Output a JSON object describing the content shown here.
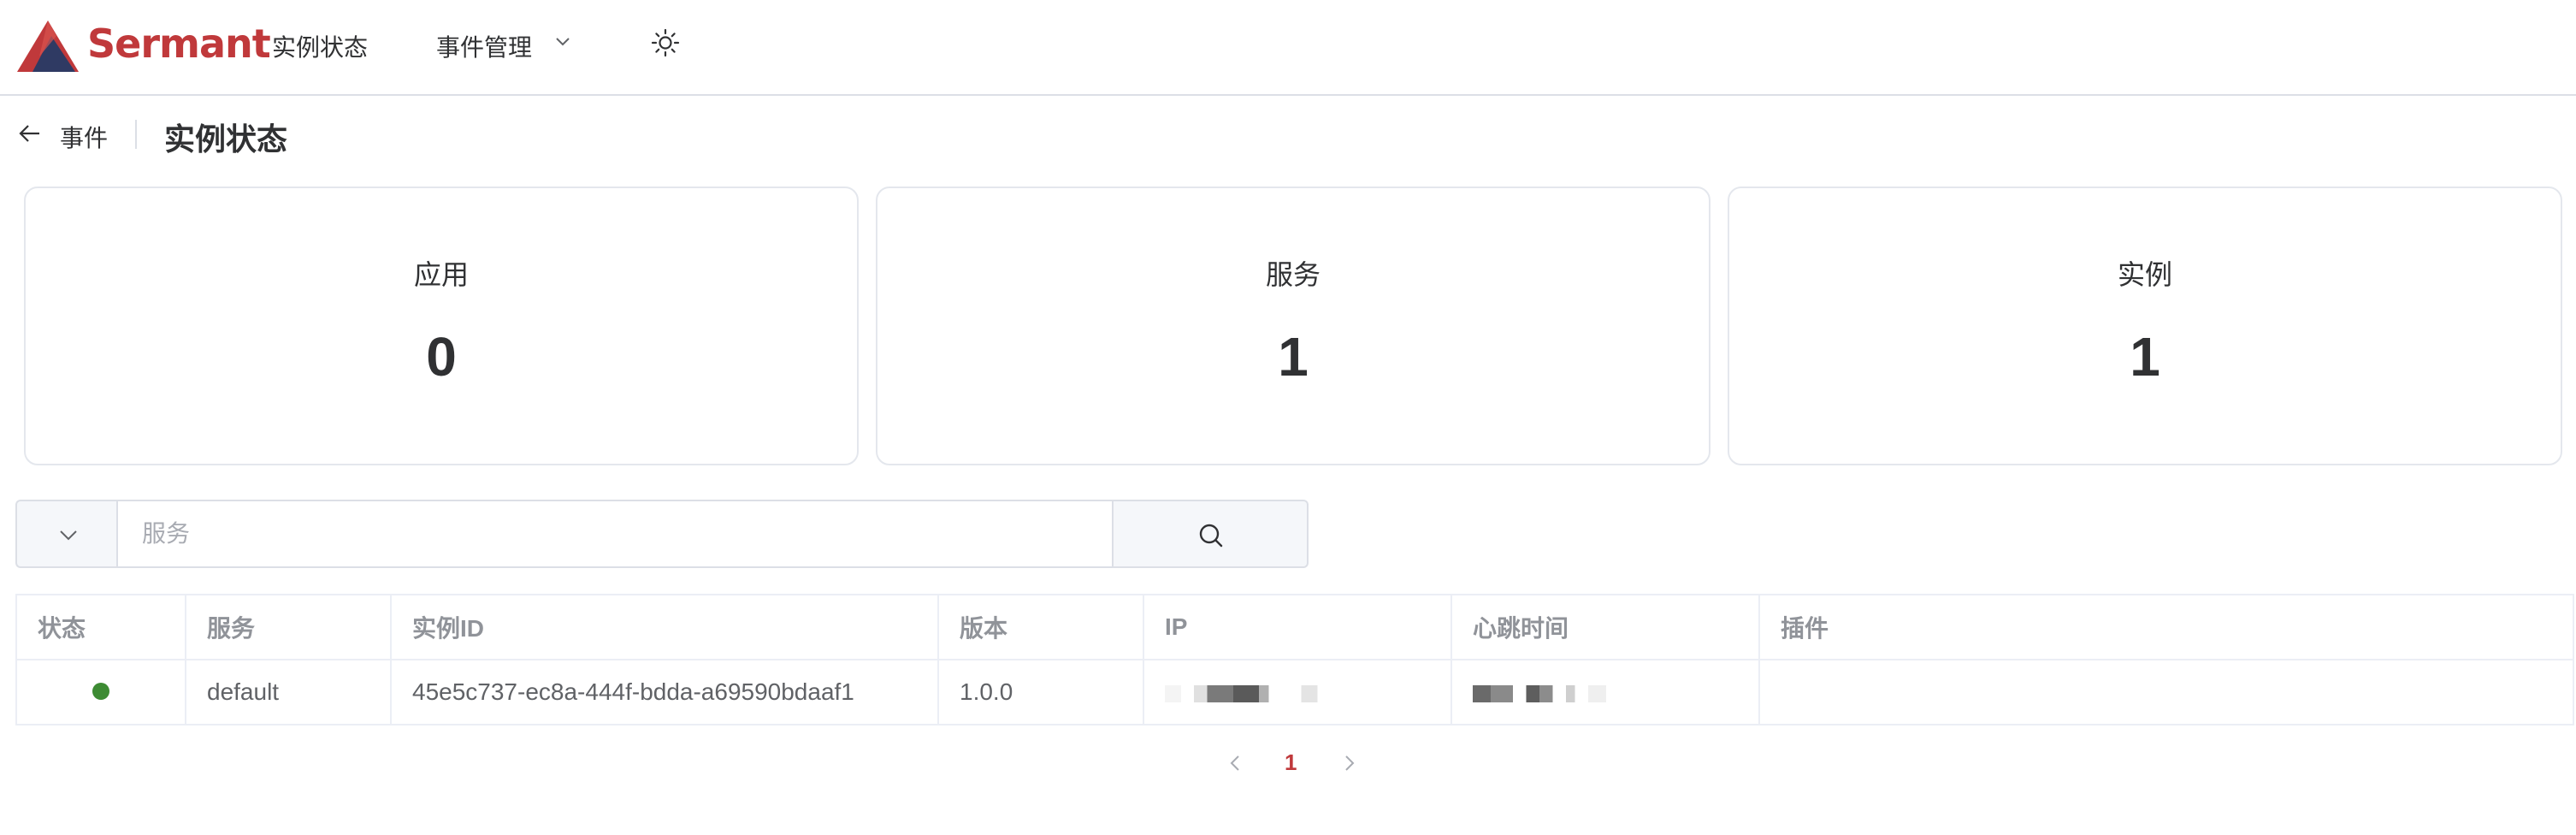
{
  "brand": {
    "name": "Sermant"
  },
  "nav": {
    "items": [
      {
        "label": "实例状态"
      },
      {
        "label": "事件管理"
      }
    ]
  },
  "page": {
    "back_label": "事件",
    "title": "实例状态"
  },
  "stats": [
    {
      "label": "应用",
      "value": "0"
    },
    {
      "label": "服务",
      "value": "1"
    },
    {
      "label": "实例",
      "value": "1"
    }
  ],
  "search": {
    "placeholder": "服务",
    "value": ""
  },
  "table": {
    "columns": [
      "状态",
      "服务",
      "实例ID",
      "版本",
      "IP",
      "心跳时间",
      "插件"
    ],
    "rows": [
      {
        "status": "online",
        "service": "default",
        "instance_id": "45e5c737-ec8a-444f-bdda-a69590bdaaf1",
        "version": "1.0.0",
        "plugin": ""
      }
    ]
  },
  "pagination": {
    "current": "1"
  },
  "colors": {
    "brand": "#c0393b",
    "status_online": "#3d8b33",
    "border": "#dcdfe6"
  },
  "icons": [
    "logo-icon",
    "chevron-down-icon",
    "sun-icon",
    "arrow-left-icon",
    "search-icon",
    "chevron-left-icon",
    "chevron-right-icon"
  ]
}
